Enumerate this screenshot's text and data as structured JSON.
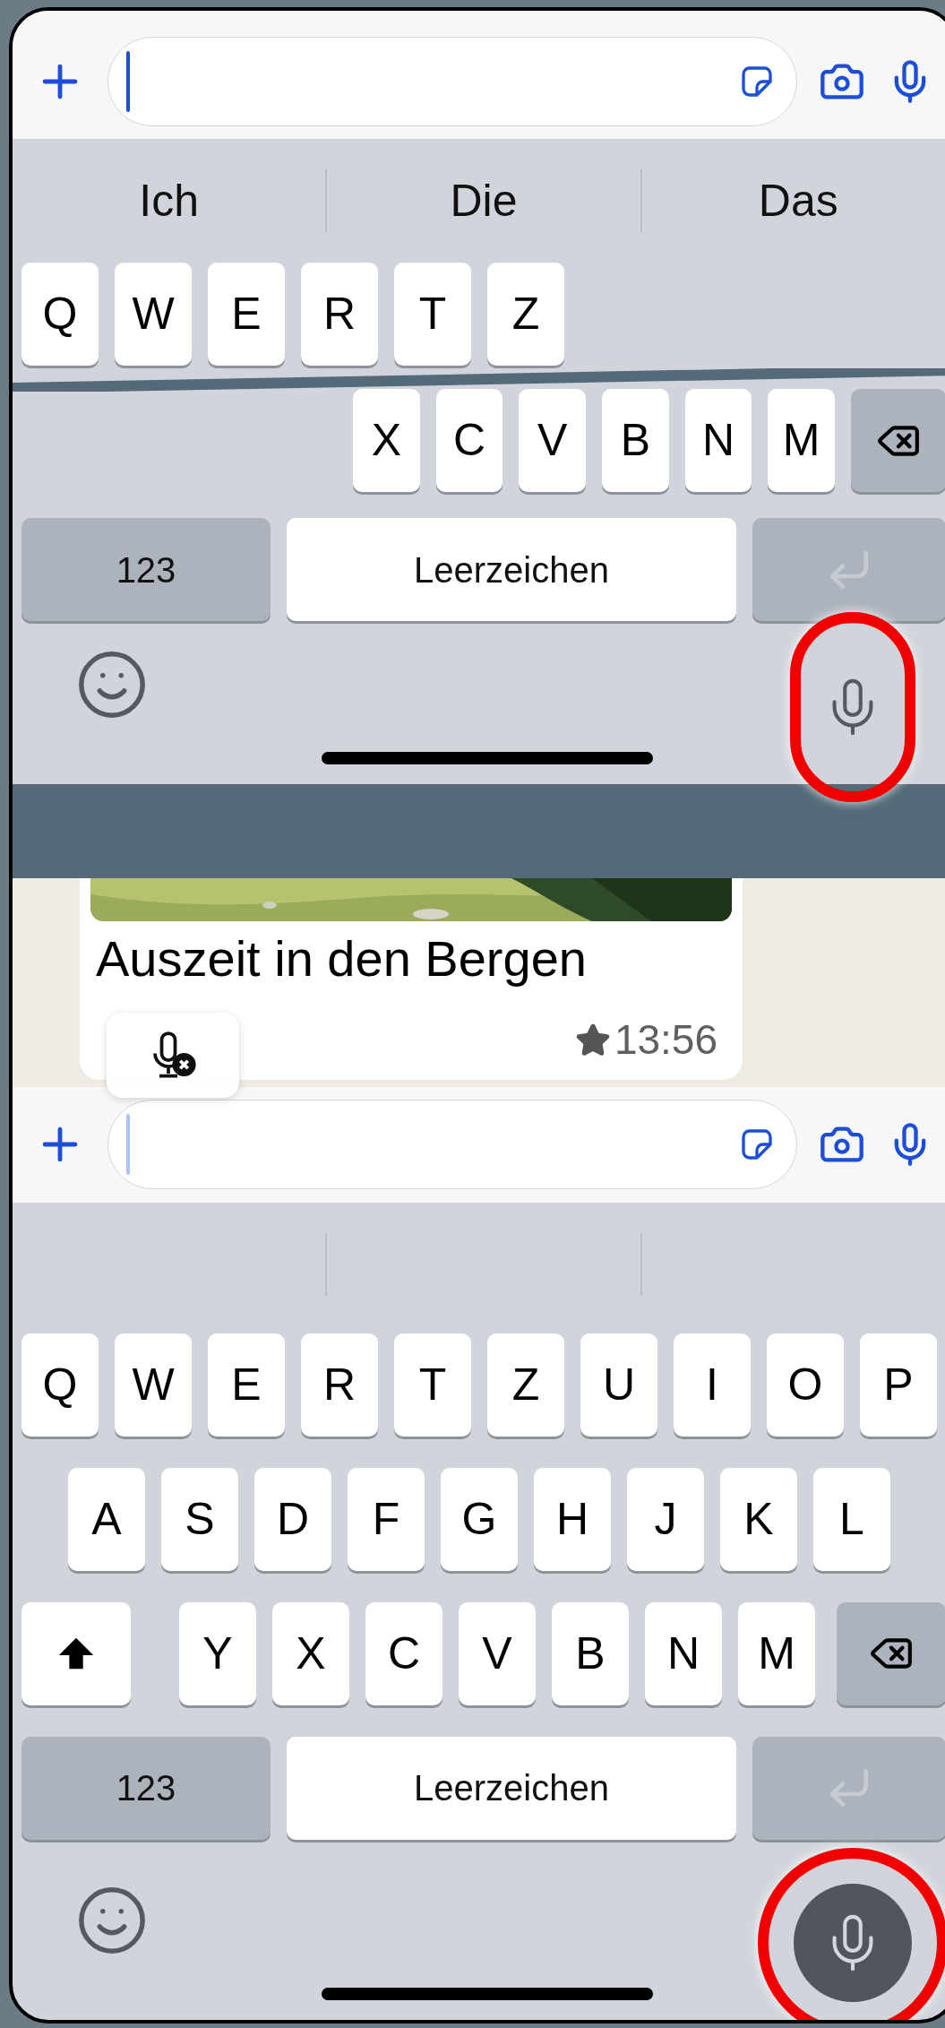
{
  "top_panel": {
    "composer": {
      "focused": true
    },
    "suggestions": [
      "Ich",
      "Die",
      "Das"
    ],
    "rows": [
      [
        "Q",
        "W",
        "E",
        "R",
        "T",
        "Z"
      ],
      [
        "X",
        "C",
        "V",
        "B",
        "N",
        "M"
      ]
    ],
    "numbers_key": "123",
    "space_key": "Leerzeichen",
    "mic_button": {
      "filled": false
    }
  },
  "chat": {
    "message": "Auszeit in den Bergen",
    "starred": true,
    "time": "13:56"
  },
  "bottom_panel": {
    "composer": {
      "focused": false
    },
    "rows": [
      [
        "Q",
        "W",
        "E",
        "R",
        "T",
        "Z",
        "U",
        "I",
        "O",
        "P"
      ],
      [
        "A",
        "S",
        "D",
        "F",
        "G",
        "H",
        "J",
        "K",
        "L"
      ],
      [
        "Y",
        "X",
        "C",
        "V",
        "B",
        "N",
        "M"
      ]
    ],
    "numbers_key": "123",
    "space_key": "Leerzeichen",
    "mic_button": {
      "filled": true
    }
  }
}
